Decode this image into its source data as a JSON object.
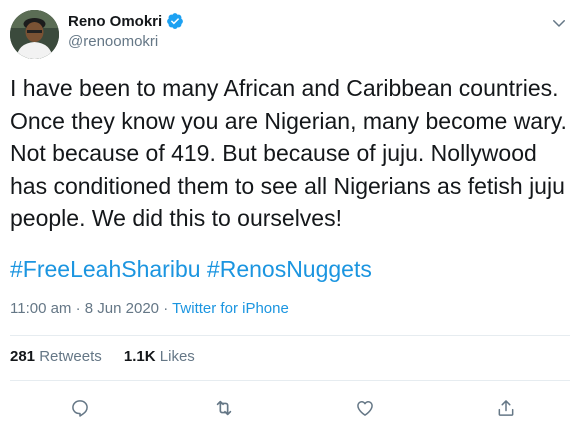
{
  "author": {
    "name": "Reno Omokri",
    "handle": "@renoomokri",
    "verified_icon": "verified-badge-icon",
    "avatar_icon": "avatar"
  },
  "tweet": {
    "text": "I have been to many African and Caribbean countries. Once they know you are Nigerian, many become wary. Not because of 419. But because of juju. Nollywood has conditioned them to see all Nigerians as fetish juju people. We did this to ourselves!",
    "hashtags": [
      "#FreeLeahSharibu",
      "#RenosNuggets"
    ],
    "time": "11:00 am",
    "date": "8 Jun 2020",
    "separator": "·",
    "source": "Twitter for iPhone"
  },
  "stats": {
    "retweets_count": "281",
    "retweets_label": "Retweets",
    "likes_count": "1.1K",
    "likes_label": "Likes"
  },
  "actions": [
    "reply-icon",
    "retweet-icon",
    "like-icon",
    "share-icon"
  ],
  "colors": {
    "text": "#14171a",
    "secondary": "#657786",
    "link": "#1b95e0",
    "divider": "#e6ecf0",
    "verified": "#1da1f2"
  }
}
